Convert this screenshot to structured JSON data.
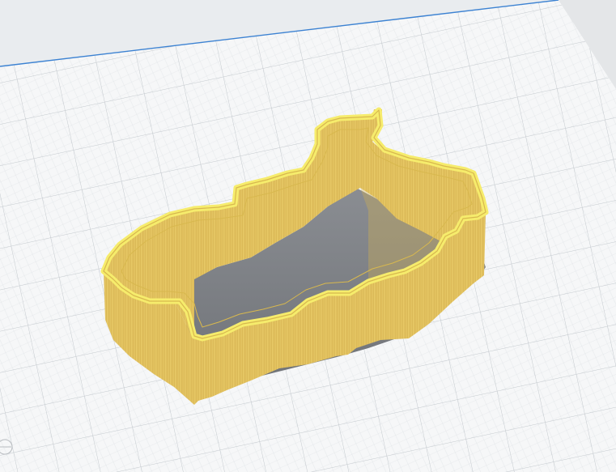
{
  "viewport": {
    "view": "3D build plate",
    "background_color": "#e9ecef",
    "plate_color": "#f7f8f9",
    "grid_minor_color": "#d9dde1",
    "grid_major_color": "#c4c9ce",
    "plate_edge_color": "#3c82d2"
  },
  "model": {
    "shape": "hollow-outline-wall",
    "wall_color": "#e6c563",
    "wall_dark_color": "#c7a94f",
    "rim_color": "#f6ec6c",
    "rim_stroke_color": "#d8b84e",
    "shadow_color": "#7c7f84"
  }
}
